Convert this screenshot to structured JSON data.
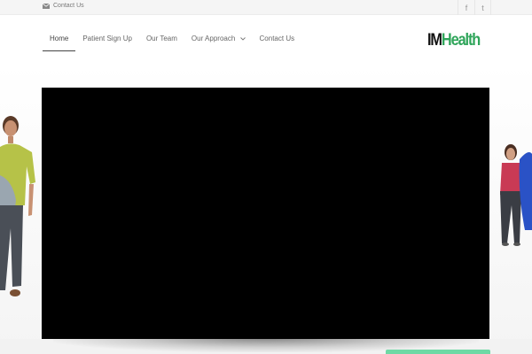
{
  "topbar": {
    "contact_label": "Contact Us"
  },
  "social": {
    "facebook_glyph": "f",
    "twitter_glyph": "t"
  },
  "nav": {
    "items": [
      {
        "label": "Home",
        "active": true
      },
      {
        "label": "Patient Sign Up"
      },
      {
        "label": "Our Team"
      },
      {
        "label": "Our Approach",
        "has_dropdown": true
      },
      {
        "label": "Contact Us"
      }
    ]
  },
  "logo": {
    "part1": "IM",
    "part2": "Health"
  },
  "colors": {
    "brand_green": "#2fa55a",
    "cta_green": "#6ed9a5",
    "video_bg": "#000000"
  },
  "icons": [
    "envelope-icon",
    "facebook-icon",
    "twitter-icon",
    "chevron-down-icon"
  ]
}
